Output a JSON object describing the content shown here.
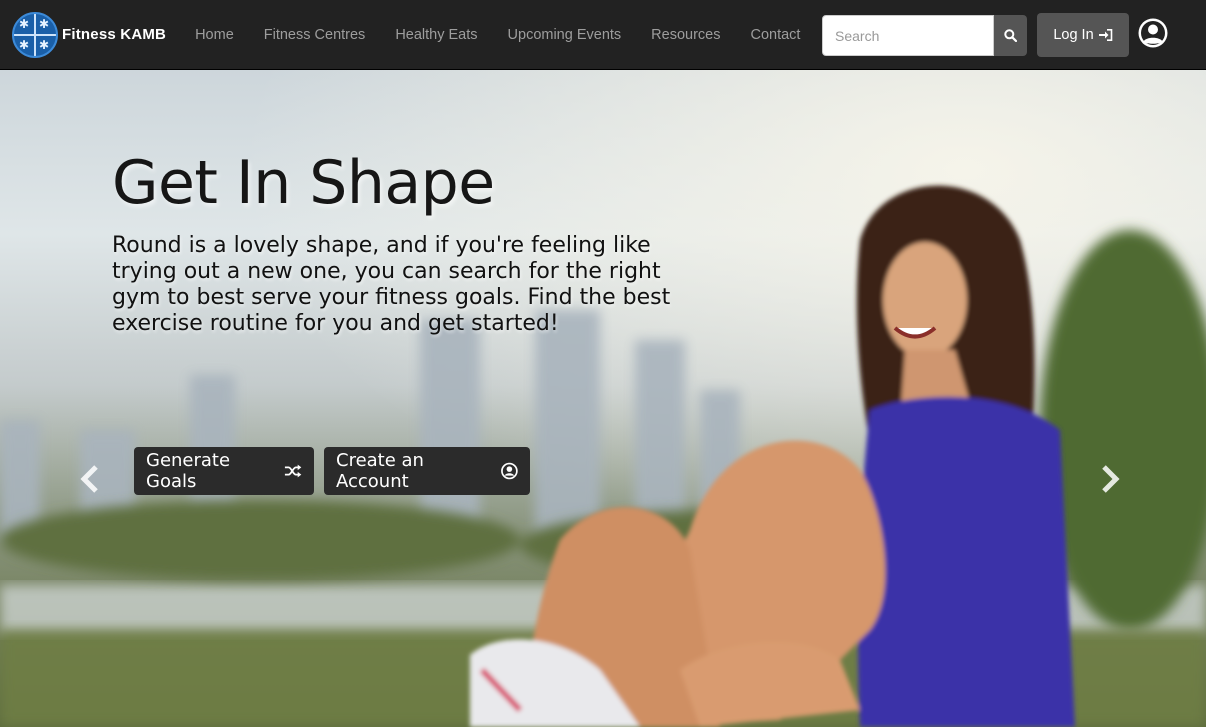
{
  "brand": {
    "name": "Fitness KAMB",
    "logo_icon": "fitness-figures-logo"
  },
  "nav": {
    "items": [
      {
        "label": "Home"
      },
      {
        "label": "Fitness Centres"
      },
      {
        "label": "Healthy Eats"
      },
      {
        "label": "Upcoming Events"
      },
      {
        "label": "Resources"
      },
      {
        "label": "Contact"
      }
    ]
  },
  "search": {
    "placeholder": "Search",
    "value": "",
    "icon": "search-icon"
  },
  "login": {
    "label": "Log In",
    "icon": "sign-in-icon"
  },
  "user": {
    "icon": "user-circle-icon"
  },
  "hero": {
    "title": "Get In Shape",
    "text": "Round is a lovely shape, and if you're feeling like trying out a new one, you can search for the right gym to best serve your fitness goals. Find the best exercise routine for you and get started!",
    "buttons": [
      {
        "label": "Generate Goals",
        "icon": "shuffle-icon"
      },
      {
        "label": "Create an Account",
        "icon": "user-circle-icon"
      }
    ],
    "prev_icon": "chevron-left-icon",
    "next_icon": "chevron-right-icon"
  },
  "colors": {
    "navbar_bg": "#222222",
    "nav_link": "#9d9d9d",
    "button_dark": "#2b2b2b",
    "button_grey": "#555555",
    "brand_blue": "#1f6fc0"
  }
}
